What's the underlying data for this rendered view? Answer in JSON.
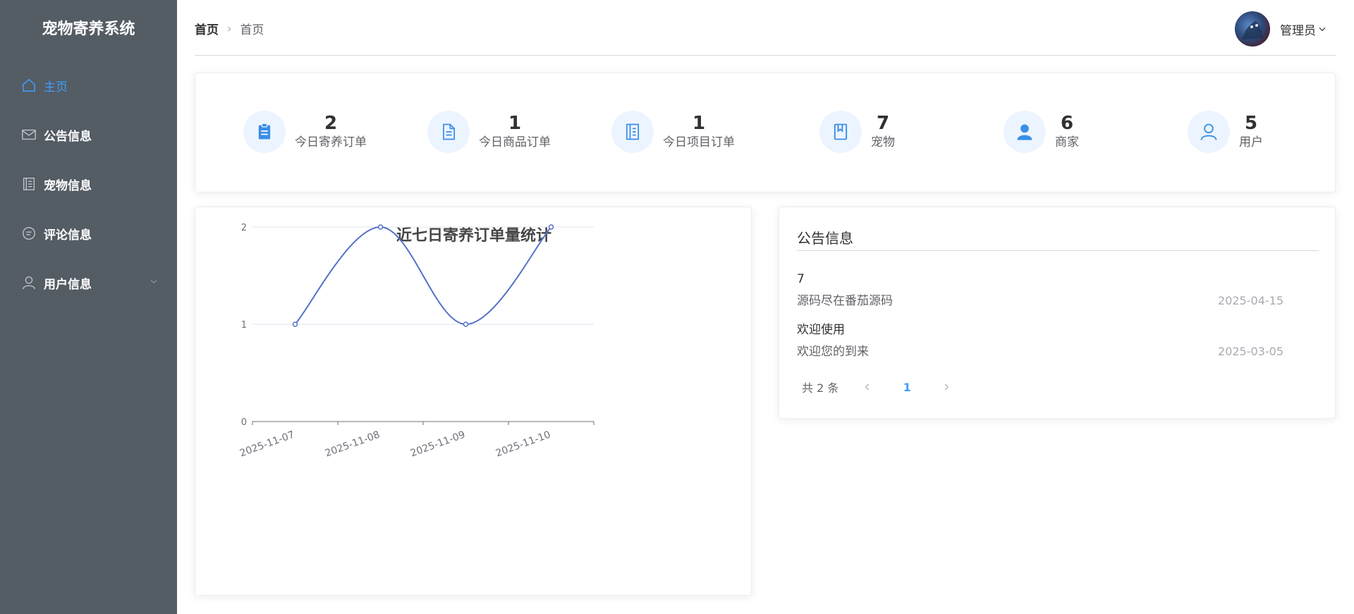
{
  "app": {
    "title": "宠物寄养系统"
  },
  "sidebar": {
    "items": [
      {
        "label": "主页",
        "icon": "home-icon",
        "active": true
      },
      {
        "label": "公告信息",
        "icon": "mail-icon"
      },
      {
        "label": "宠物信息",
        "icon": "document-icon"
      },
      {
        "label": "评论信息",
        "icon": "chat-icon"
      },
      {
        "label": "用户信息",
        "icon": "user-icon",
        "expandable": true
      }
    ]
  },
  "header": {
    "breadcrumb": [
      "首页",
      "首页"
    ],
    "user": {
      "name": "管理员"
    }
  },
  "stats": [
    {
      "value": "2",
      "label": "今日寄养订单",
      "icon": "clipboard-icon"
    },
    {
      "value": "1",
      "label": "今日商品订单",
      "icon": "document-icon"
    },
    {
      "value": "1",
      "label": "今日项目订单",
      "icon": "notebook-icon"
    },
    {
      "value": "7",
      "label": "宠物",
      "icon": "book-icon"
    },
    {
      "value": "6",
      "label": "商家",
      "icon": "user-filled-icon"
    },
    {
      "value": "5",
      "label": "用户",
      "icon": "user-icon"
    }
  ],
  "notice": {
    "title": "公告信息",
    "items": [
      {
        "title": "7",
        "content": "源码尽在番茄源码",
        "date": "2025-04-15"
      },
      {
        "title": "欢迎使用",
        "content": "欢迎您的到来",
        "date": "2025-03-05"
      }
    ],
    "pagination": {
      "total_text": "共 2 条",
      "page": "1"
    }
  },
  "chart_data": {
    "type": "line",
    "title": "近七日寄养订单量统计",
    "categories": [
      "2025-11-07",
      "2025-11-08",
      "2025-11-09",
      "2025-11-10"
    ],
    "series": [
      {
        "values": [
          1,
          2,
          1,
          2
        ]
      }
    ],
    "ylim": [
      0,
      2
    ],
    "yticks": [
      0,
      1,
      2
    ],
    "smooth": true,
    "grid": true,
    "color": "#5470c6"
  },
  "colors": {
    "sidebar_bg": "#545c64",
    "accent": "#409eff",
    "line": "#5470c6"
  }
}
